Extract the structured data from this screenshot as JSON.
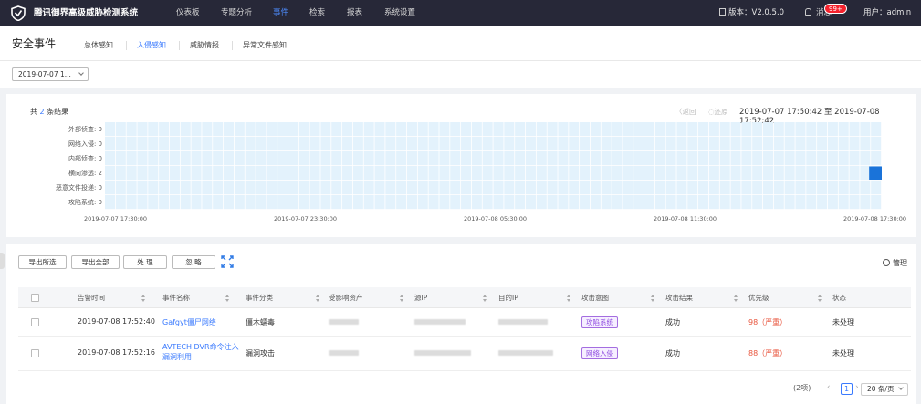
{
  "app": {
    "title": "腾讯御界高级威胁检测系统",
    "nav": [
      "仪表板",
      "专题分析",
      "事件",
      "检索",
      "报表",
      "系统设置"
    ],
    "version": "版本：V2.0.5.0",
    "messages": "消息",
    "message_badge": "99+",
    "user": "用户：admin"
  },
  "page": {
    "title": "安全事件",
    "tabs": [
      "总体感知",
      "入侵感知",
      "威胁情报",
      "异常文件感知"
    ],
    "date_filter": "2019-07-07 1..."
  },
  "chart_data": {
    "type": "heatmap",
    "summary_prefix": "共",
    "summary_count": "2",
    "summary_suffix": "条结果",
    "back": "〈返回",
    "refresh": "◌还原",
    "range": "2019-07-07 17:50:42 至 2019-07-08 17:52:42",
    "categories": [
      "外部侦查: 0",
      "网络入侵: 0",
      "内部侦查: 0",
      "横向渗透: 2",
      "恶意文件投递: 0",
      "攻陷系统: 0"
    ],
    "x_ticks": [
      "2019-07-07 17:30:00",
      "2019-07-07 23:30:00",
      "2019-07-08 05:30:00",
      "2019-07-08 11:30:00",
      "2019-07-08 17:30:00"
    ],
    "highlight": {
      "category_index": 3,
      "time": "2019-07-08 17:30:00"
    },
    "cell_color": "#e3f2fc",
    "highlight_color": "#1a73d9"
  },
  "toolbar": {
    "export_selected": "导出所选",
    "export_all": "导出全部",
    "handle": "处 理",
    "ignore": "忽 略",
    "manage": "管理"
  },
  "table": {
    "headers": [
      "告警时间",
      "事件名称",
      "事件分类",
      "受影响资产",
      "源IP",
      "目的IP",
      "攻击意图",
      "攻击结果",
      "优先级",
      "状态"
    ],
    "rows": [
      {
        "time": "2019-07-08 17:52:40",
        "name": "Gafgyt僵尸网络",
        "category": "僵木蠕毒",
        "intent": "攻陷系统",
        "result": "成功",
        "priority": "98（严重）",
        "status": "未处理"
      },
      {
        "time": "2019-07-08 17:52:16",
        "name": "AVTECH DVR命令注入漏洞利用",
        "category": "漏洞攻击",
        "intent": "网络入侵",
        "result": "成功",
        "priority": "88（严重）",
        "status": "未处理"
      }
    ]
  },
  "pagination": {
    "total": "(2项)",
    "current": "1",
    "page_size": "20 条/页"
  }
}
